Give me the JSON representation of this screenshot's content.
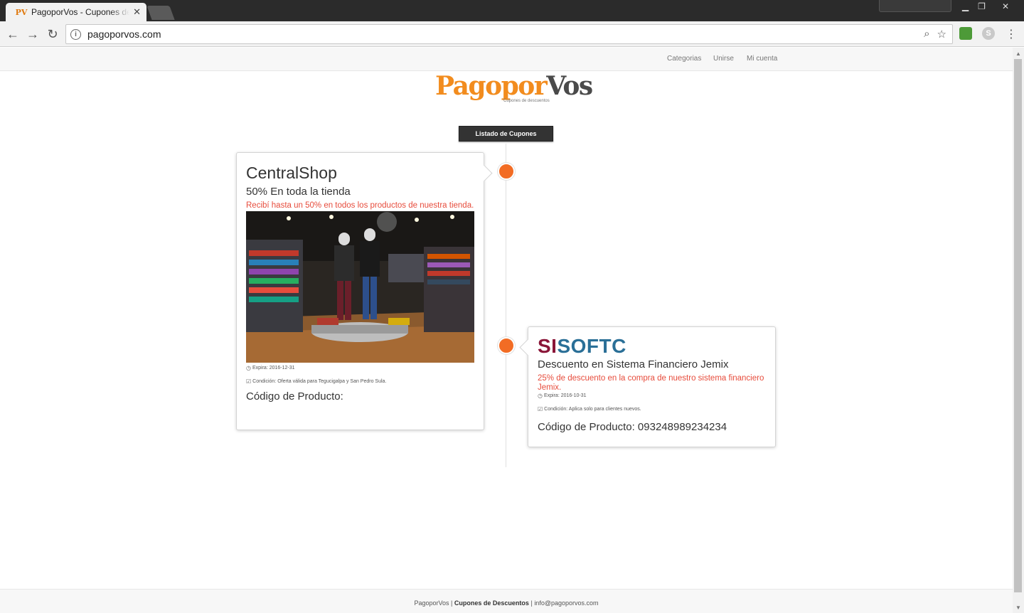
{
  "browser": {
    "tab_title": "PagoporVos - Cupones de Descuentos",
    "tab_favicon": "PV",
    "url": "pagoporvos.com"
  },
  "topnav": {
    "items": [
      "Categorias",
      "Unirse",
      "Mi cuenta"
    ]
  },
  "logo": {
    "part1": "Pagopor",
    "part2": "Vos",
    "tagline": "Cupones de descuentos",
    "colors": {
      "orange": "#f28c1e",
      "dark": "#4a4a4a"
    }
  },
  "list_title": "Listado de Cupones",
  "timeline": {
    "dot_color": "#f26c24"
  },
  "coupons": [
    {
      "store": "CentralShop",
      "title": "50% En toda la tienda",
      "description": "Recibí hasta un 50% en todos los productos de nuestra tienda.",
      "image": "store-interior-photo",
      "expires": "Expira: 2016-12-31",
      "condition": "Condición: Oferta válida para Tegucigalpa y San Pedro Sula.",
      "code_label": "Código de Producto:"
    },
    {
      "store_logo_a": "SI",
      "store_logo_b": "SOFTC",
      "title": "Descuento en Sistema Financiero Jemix",
      "description": "25% de descuento en la compra de nuestro sistema financiero Jemix.",
      "expires": "Expira: 2016-10-31",
      "condition": "Condición: Aplica solo para clientes nuevos.",
      "code_label": "Código de Producto: 093248989234234"
    }
  ],
  "footer": {
    "brand": "PagoporVos",
    "sep": "|",
    "tagline": "Cupones de Descuentos",
    "email": "info@pagoporvos.com"
  },
  "colors": {
    "accent_red": "#e74c3c",
    "sisoftc_red": "#8a1538",
    "sisoftc_blue": "#2a6f97"
  }
}
